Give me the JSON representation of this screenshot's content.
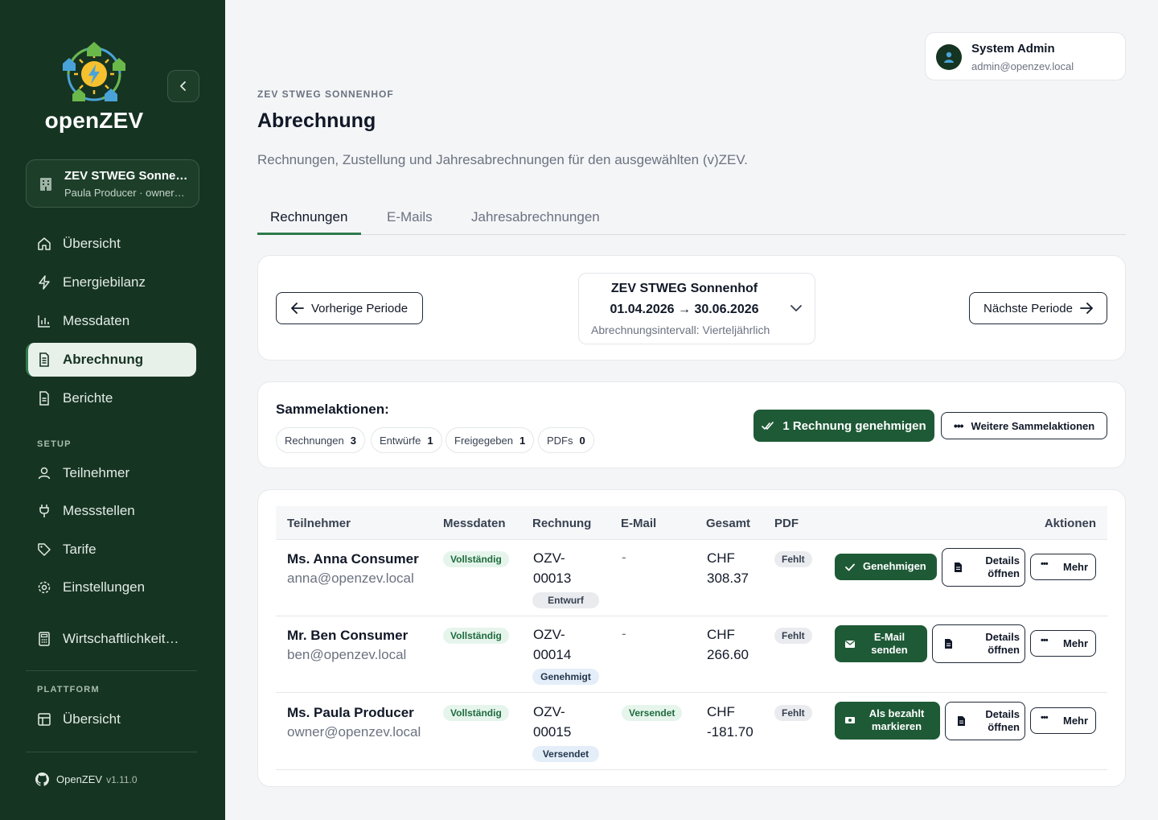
{
  "sidebar": {
    "logo_text": "openZEV",
    "zev": {
      "name": "ZEV STWEG Sonnenhof",
      "subtitle": "Paula Producer · owner@openzev.local"
    },
    "nav": [
      {
        "label": "Übersicht",
        "icon": "home-icon"
      },
      {
        "label": "Energiebilanz",
        "icon": "lightning-icon"
      },
      {
        "label": "Messdaten",
        "icon": "bar-chart-icon"
      },
      {
        "label": "Abrechnung",
        "icon": "document-icon",
        "active": true
      },
      {
        "label": "Berichte",
        "icon": "file-icon"
      }
    ],
    "setup_label": "SETUP",
    "setup": [
      {
        "label": "Teilnehmer",
        "icon": "user-icon"
      },
      {
        "label": "Messstellen",
        "icon": "plug-icon"
      },
      {
        "label": "Tarife",
        "icon": "tag-icon"
      },
      {
        "label": "Einstellungen",
        "icon": "gear-icon"
      },
      {
        "label": "Wirtschaftlichkeitsrechner",
        "icon": "calculator-icon"
      }
    ],
    "platform_label": "PLATTFORM",
    "platform": [
      {
        "label": "Übersicht",
        "icon": "layout-icon"
      }
    ],
    "footer": {
      "name": "OpenZEV",
      "version": "v1.11.0"
    }
  },
  "user": {
    "name": "System Admin",
    "email": "admin@openzev.local"
  },
  "header": {
    "eyebrow": "ZEV STWEG SONNENHOF",
    "title": "Abrechnung",
    "subtitle": "Rechnungen, Zustellung und Jahresabrechnungen für den ausgewählten (v)ZEV."
  },
  "tabs": [
    {
      "label": "Rechnungen",
      "active": true
    },
    {
      "label": "E-Mails"
    },
    {
      "label": "Jahresabrechnungen"
    }
  ],
  "period": {
    "prev_label": "Vorherige Periode",
    "next_label": "Nächste Periode",
    "zev_name": "ZEV STWEG Sonnenhof",
    "range": "01.04.2026 → 30.06.2026",
    "interval": "Abrechnungsintervall: Vierteljährlich"
  },
  "bulk": {
    "title": "Sammelaktionen:",
    "counts": [
      {
        "label": "Rechnungen",
        "value": "3"
      },
      {
        "label": "Entwürfe",
        "value": "1"
      },
      {
        "label": "Freigegeben",
        "value": "1"
      },
      {
        "label": "PDFs",
        "value": "0"
      }
    ],
    "approve_label": "1 Rechnung genehmigen",
    "more_label": "Weitere Sammelaktionen"
  },
  "table": {
    "columns": [
      "Teilnehmer",
      "Messdaten",
      "Rechnung",
      "E-Mail",
      "Gesamt",
      "PDF",
      "Aktionen"
    ],
    "rows": [
      {
        "name": "Ms. Anna Consumer",
        "email": "anna@openzev.local",
        "messdaten": "Vollständig",
        "invoice_l1": "OZV-",
        "invoice_l2": "00013",
        "invoice_status": "Entwurf",
        "mail": "-",
        "total_l1": "CHF",
        "total_l2": "308.37",
        "pdf": "Fehlt",
        "primary_action": "Genehmigen",
        "details": "Details öffnen",
        "more": "Mehr"
      },
      {
        "name": "Mr. Ben Consumer",
        "email": "ben@openzev.local",
        "messdaten": "Vollständig",
        "invoice_l1": "OZV-",
        "invoice_l2": "00014",
        "invoice_status": "Genehmigt",
        "mail": "-",
        "total_l1": "CHF",
        "total_l2": "266.60",
        "pdf": "Fehlt",
        "primary_action": "E-Mail senden",
        "details": "Details öffnen",
        "more": "Mehr"
      },
      {
        "name": "Ms. Paula Producer",
        "email": "owner@openzev.local",
        "messdaten": "Vollständig",
        "invoice_l1": "OZV-",
        "invoice_l2": "00015",
        "invoice_status": "Versendet",
        "mail": "Versendet",
        "total_l1": "CHF",
        "total_l2": "-181.70",
        "pdf": "Fehlt",
        "primary_action": "Als bezahlt markieren",
        "details": "Details öffnen",
        "more": "Mehr"
      }
    ]
  },
  "colors": {
    "sidebar": "#163422",
    "accent": "#1e5a36",
    "active_line": "#2f7a4b"
  }
}
